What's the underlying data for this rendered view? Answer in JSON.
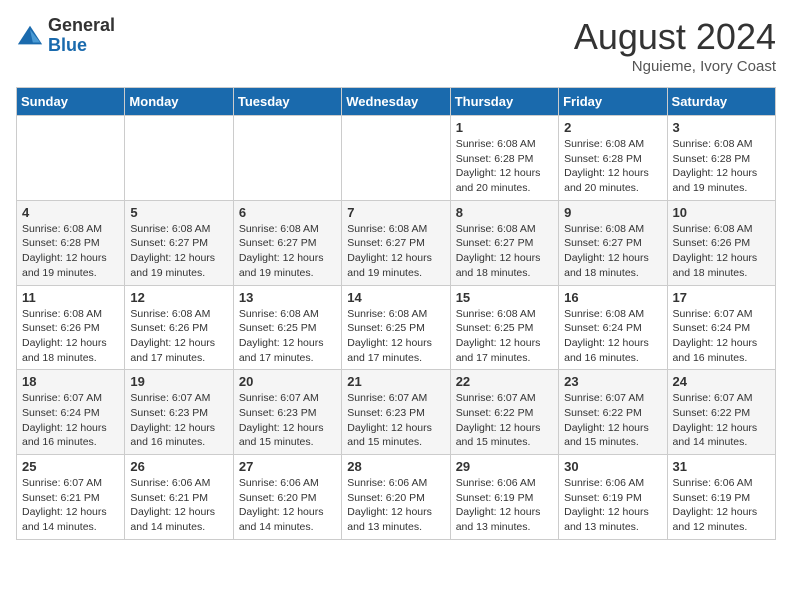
{
  "logo": {
    "general": "General",
    "blue": "Blue"
  },
  "title": {
    "month_year": "August 2024",
    "location": "Nguieme, Ivory Coast"
  },
  "weekdays": [
    "Sunday",
    "Monday",
    "Tuesday",
    "Wednesday",
    "Thursday",
    "Friday",
    "Saturday"
  ],
  "weeks": [
    [
      {
        "day": "",
        "info": ""
      },
      {
        "day": "",
        "info": ""
      },
      {
        "day": "",
        "info": ""
      },
      {
        "day": "",
        "info": ""
      },
      {
        "day": "1",
        "info": "Sunrise: 6:08 AM\nSunset: 6:28 PM\nDaylight: 12 hours and 20 minutes."
      },
      {
        "day": "2",
        "info": "Sunrise: 6:08 AM\nSunset: 6:28 PM\nDaylight: 12 hours and 20 minutes."
      },
      {
        "day": "3",
        "info": "Sunrise: 6:08 AM\nSunset: 6:28 PM\nDaylight: 12 hours and 19 minutes."
      }
    ],
    [
      {
        "day": "4",
        "info": "Sunrise: 6:08 AM\nSunset: 6:28 PM\nDaylight: 12 hours and 19 minutes."
      },
      {
        "day": "5",
        "info": "Sunrise: 6:08 AM\nSunset: 6:27 PM\nDaylight: 12 hours and 19 minutes."
      },
      {
        "day": "6",
        "info": "Sunrise: 6:08 AM\nSunset: 6:27 PM\nDaylight: 12 hours and 19 minutes."
      },
      {
        "day": "7",
        "info": "Sunrise: 6:08 AM\nSunset: 6:27 PM\nDaylight: 12 hours and 19 minutes."
      },
      {
        "day": "8",
        "info": "Sunrise: 6:08 AM\nSunset: 6:27 PM\nDaylight: 12 hours and 18 minutes."
      },
      {
        "day": "9",
        "info": "Sunrise: 6:08 AM\nSunset: 6:27 PM\nDaylight: 12 hours and 18 minutes."
      },
      {
        "day": "10",
        "info": "Sunrise: 6:08 AM\nSunset: 6:26 PM\nDaylight: 12 hours and 18 minutes."
      }
    ],
    [
      {
        "day": "11",
        "info": "Sunrise: 6:08 AM\nSunset: 6:26 PM\nDaylight: 12 hours and 18 minutes."
      },
      {
        "day": "12",
        "info": "Sunrise: 6:08 AM\nSunset: 6:26 PM\nDaylight: 12 hours and 17 minutes."
      },
      {
        "day": "13",
        "info": "Sunrise: 6:08 AM\nSunset: 6:25 PM\nDaylight: 12 hours and 17 minutes."
      },
      {
        "day": "14",
        "info": "Sunrise: 6:08 AM\nSunset: 6:25 PM\nDaylight: 12 hours and 17 minutes."
      },
      {
        "day": "15",
        "info": "Sunrise: 6:08 AM\nSunset: 6:25 PM\nDaylight: 12 hours and 17 minutes."
      },
      {
        "day": "16",
        "info": "Sunrise: 6:08 AM\nSunset: 6:24 PM\nDaylight: 12 hours and 16 minutes."
      },
      {
        "day": "17",
        "info": "Sunrise: 6:07 AM\nSunset: 6:24 PM\nDaylight: 12 hours and 16 minutes."
      }
    ],
    [
      {
        "day": "18",
        "info": "Sunrise: 6:07 AM\nSunset: 6:24 PM\nDaylight: 12 hours and 16 minutes."
      },
      {
        "day": "19",
        "info": "Sunrise: 6:07 AM\nSunset: 6:23 PM\nDaylight: 12 hours and 16 minutes."
      },
      {
        "day": "20",
        "info": "Sunrise: 6:07 AM\nSunset: 6:23 PM\nDaylight: 12 hours and 15 minutes."
      },
      {
        "day": "21",
        "info": "Sunrise: 6:07 AM\nSunset: 6:23 PM\nDaylight: 12 hours and 15 minutes."
      },
      {
        "day": "22",
        "info": "Sunrise: 6:07 AM\nSunset: 6:22 PM\nDaylight: 12 hours and 15 minutes."
      },
      {
        "day": "23",
        "info": "Sunrise: 6:07 AM\nSunset: 6:22 PM\nDaylight: 12 hours and 15 minutes."
      },
      {
        "day": "24",
        "info": "Sunrise: 6:07 AM\nSunset: 6:22 PM\nDaylight: 12 hours and 14 minutes."
      }
    ],
    [
      {
        "day": "25",
        "info": "Sunrise: 6:07 AM\nSunset: 6:21 PM\nDaylight: 12 hours and 14 minutes."
      },
      {
        "day": "26",
        "info": "Sunrise: 6:06 AM\nSunset: 6:21 PM\nDaylight: 12 hours and 14 minutes."
      },
      {
        "day": "27",
        "info": "Sunrise: 6:06 AM\nSunset: 6:20 PM\nDaylight: 12 hours and 14 minutes."
      },
      {
        "day": "28",
        "info": "Sunrise: 6:06 AM\nSunset: 6:20 PM\nDaylight: 12 hours and 13 minutes."
      },
      {
        "day": "29",
        "info": "Sunrise: 6:06 AM\nSunset: 6:19 PM\nDaylight: 12 hours and 13 minutes."
      },
      {
        "day": "30",
        "info": "Sunrise: 6:06 AM\nSunset: 6:19 PM\nDaylight: 12 hours and 13 minutes."
      },
      {
        "day": "31",
        "info": "Sunrise: 6:06 AM\nSunset: 6:19 PM\nDaylight: 12 hours and 12 minutes."
      }
    ]
  ]
}
